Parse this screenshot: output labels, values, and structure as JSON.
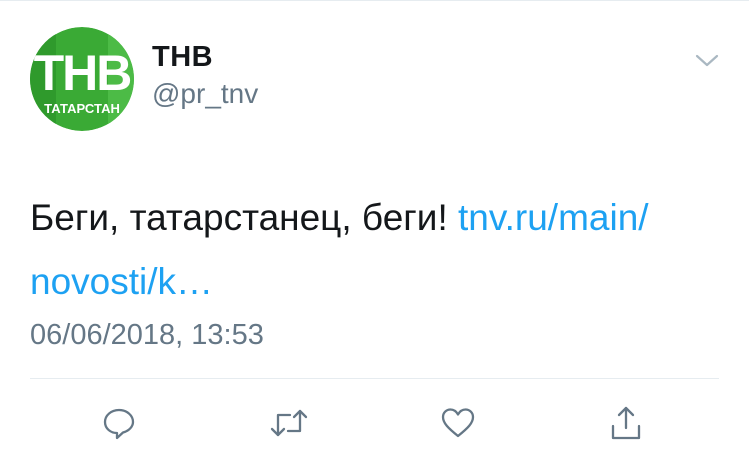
{
  "tweet": {
    "avatar": {
      "logo_text": "ТНВ",
      "logo_subtext": "ТАТАРСТАН",
      "brand_green": "#3aaa35",
      "icon": "tnv-logo-avatar"
    },
    "author_name": "ТНВ",
    "author_handle": "@pr_tnv",
    "menu_icon": "chevron-down-icon",
    "text": "Беги, татарстанец, беги! ",
    "link_line1": "tnv.ru/main/",
    "link_line2": "novosti/k…",
    "timestamp": "06/06/2018, 13:53"
  },
  "actions": {
    "reply_icon": "reply-icon",
    "retweet_icon": "retweet-icon",
    "like_icon": "heart-icon",
    "share_icon": "share-icon"
  },
  "colors": {
    "text": "#14171a",
    "secondary": "#657786",
    "link": "#1da1f2",
    "divider": "#e6ecf0"
  }
}
